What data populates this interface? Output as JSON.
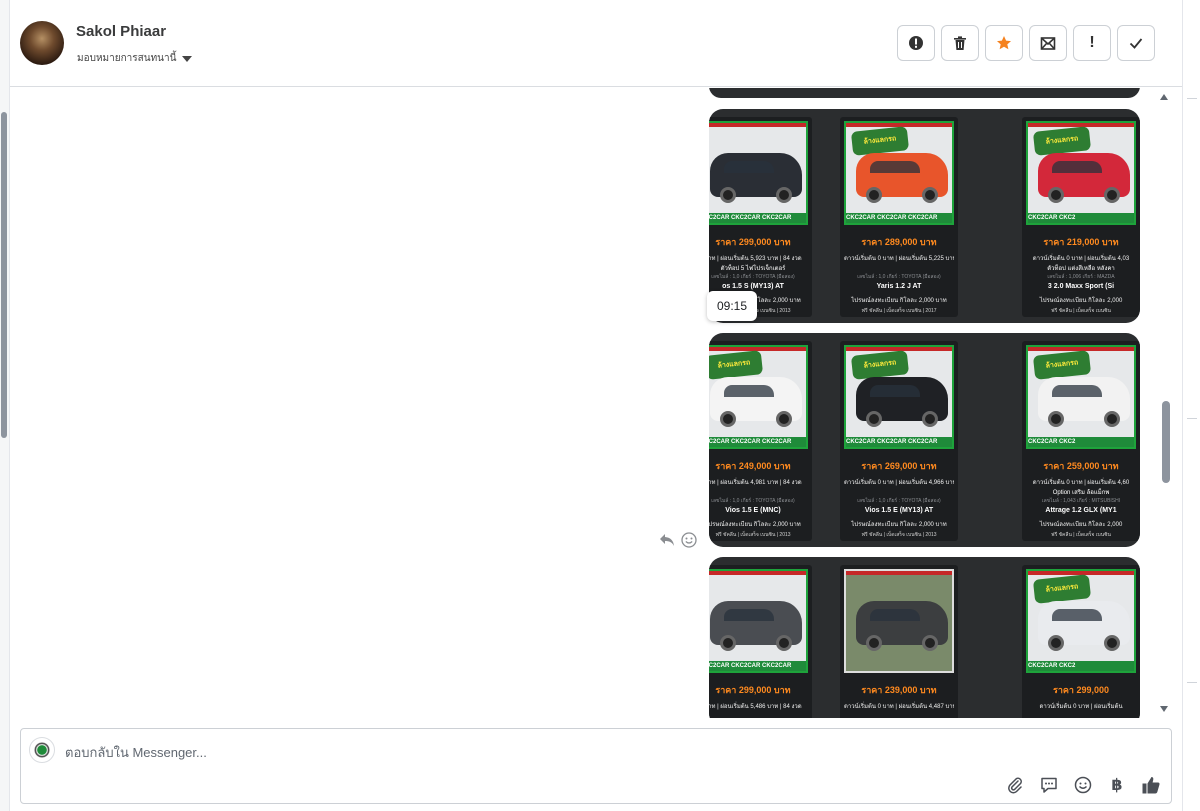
{
  "header": {
    "contact_name": "Sakol Phiaar",
    "assign_label": "มอบหมายการสนทนานี้"
  },
  "toolbar": {
    "buttons": [
      {
        "name": "mark-important-button",
        "icon": "exclamation-circle-icon"
      },
      {
        "name": "delete-button",
        "icon": "trash-icon"
      },
      {
        "name": "star-button",
        "icon": "star-icon",
        "color": "#f5821f"
      },
      {
        "name": "mark-unread-button",
        "icon": "envelope-icon"
      },
      {
        "name": "mark-spam-button",
        "icon": "exclamation-icon",
        "label": "!"
      },
      {
        "name": "mark-done-button",
        "icon": "check-icon"
      }
    ]
  },
  "chat": {
    "timestamp": "09:15",
    "albums": [
      {
        "cards": [
          {
            "price": "ราคา 299,000 บาท",
            "finance": "บาท | ผ่อนเริ่มต้น 5,923 บาท | 84 งวด",
            "feature": "ตัวท็อป 5 ไฟโปรเจ็กเตอร์",
            "spec": "เลขไมล์ : 1,0 เกียร์ : TOYOTA (มือสอง)",
            "model": "os 1.5 S (MY13) AT",
            "promo": "ไปรษณ์ลงทะเบียน กิโลละ 2,000 บาท",
            "footer": "ฟรี ชัคลีน | เบ็ดเสร็จ เบนซิน | 2013",
            "band": "CKC2CAR CKC2CAR CKC2CAR",
            "color": "#2a2e35"
          },
          {
            "price": "ราคา 289,000 บาท",
            "finance": "ดาวน์เริ่มต้น 0 บาท | ผ่อนเริ่มต้น 5,225 บาท | 84 งวด",
            "feature": "",
            "spec": "เลขไมล์ : 1,0 เกียร์ : TOYOTA (มือสอง)",
            "model": "Yaris 1.2 J AT",
            "promo": "ไปรษณ์ลงทะเบียน กิโลละ 2,000 บาท",
            "footer": "ฟรี ชัคลีน | เบ็ดเสร็จ เบนซิน | 2017",
            "band": "CKC2CAR CKC2CAR CKC2CAR",
            "badge": "ล้างแลกรถ 20,000บาท",
            "color": "#e8552b"
          },
          {
            "price": "ราคา 219,000 บาท",
            "finance": "ดาวน์เริ่มต้น 0 บาท | ผ่อนเริ่มต้น 4,03",
            "feature": "ตัวท็อป แต่งสีเหลือ หลังคา",
            "spec": "เลขไมล์ : 1,006 เกียร์ : MAZDA",
            "model": "3 2.0 Maxx Sport (Si",
            "promo": "ไปรษณ์ลงทะเบียน กิโลละ 2,000",
            "footer": "ฟรี ชัคลีน | เบ็ดเสร็จ เบนซิน",
            "band": "CKC2CAR CKC2",
            "badge": "ล้างแลกรถ 20,000บาท",
            "color": "#d3283a"
          }
        ]
      },
      {
        "cards": [
          {
            "price": "ราคา 249,000 บาท",
            "finance": "บาท | ผ่อนเริ่มต้น 4,981 บาท | 84 งวด",
            "feature": "",
            "spec": "เลขไมล์ : 1,0 เกียร์ : TOYOTA (มือสอง)",
            "model": "Vios 1.5 E (MNC)",
            "promo": "ไปรษณ์ลงทะเบียน กิโลละ 2,000 บาท",
            "footer": "ฟรี ชัคลีน | เบ็ดเสร็จ เบนซิน | 2013",
            "band": "CKC2CAR CKC2CAR CKC2CAR",
            "badge": "ล้างแลกรถ 20,000บาท",
            "color": "#f4f4f4"
          },
          {
            "price": "ราคา 269,000 บาท",
            "finance": "ดาวน์เริ่มต้น 0 บาท | ผ่อนเริ่มต้น 4,966 บาท | 84 งวด",
            "feature": "",
            "spec": "เลขไมล์ : 1,0 เกียร์ : TOYOTA (มือสอง)",
            "model": "Vios 1.5 E (MY13) AT",
            "promo": "ไปรษณ์ลงทะเบียน กิโลละ 2,000 บาท",
            "footer": "ฟรี ชัคลีน | เบ็ดเสร็จ เบนซิน | 2013",
            "band": "CKC2CAR CKC2CAR CKC2CAR",
            "badge": "ล้างแลกรถ 20,000บาท",
            "color": "#1f2125"
          },
          {
            "price": "ราคา 259,000 บาท",
            "finance": "ดาวน์เริ่มต้น 0 บาท | ผ่อนเริ่มต้น 4,60",
            "feature": "Option เสริม ล้อแม็กพ",
            "spec": "เลขไมล์ : 1,043 เกียร์ : MITSUBISHI",
            "model": "Attrage 1.2 GLX (MY1",
            "promo": "ไปรษณ์ลงทะเบียน กิโลละ 2,000",
            "footer": "ฟรี ชัคลีน | เบ็ดเสร็จ เบนซิน",
            "band": "CKC2CAR CKC2",
            "badge": "ล้างแลกรถ 20,000บาท",
            "color": "#f2f2f2"
          }
        ]
      },
      {
        "cards": [
          {
            "price": "ราคา 299,000 บาท",
            "finance": "บาท | ผ่อนเริ่มต้น 5,486 บาท | 84 งวด",
            "model": "",
            "band": "CKC2CAR CKC2CAR CKC2CAR",
            "color": "#4a4d52"
          },
          {
            "price": "ราคา 239,000 บาท",
            "finance": "ดาวน์เริ่มต้น 0 บาท | ผ่อนเริ่มต้น 4,487 บาท | 84 งวด",
            "model": "",
            "band": "",
            "color": "#3c3e40"
          },
          {
            "price": "ราคา 299,000",
            "finance": "ดาวน์เริ่มต้น 0 บาท | ผ่อนเริ่มต้น",
            "model": "",
            "band": "CKC2CAR CKC2",
            "badge": "ล้างแลกรถ 20,000บาท",
            "color": "#e9ebee"
          }
        ]
      }
    ]
  },
  "composer": {
    "placeholder": "ตอบกลับใน Messenger...",
    "tools": [
      "attachment-icon",
      "saved-reply-icon",
      "emoji-icon",
      "baht-icon",
      "like-icon"
    ],
    "baht_symbol": "฿"
  }
}
